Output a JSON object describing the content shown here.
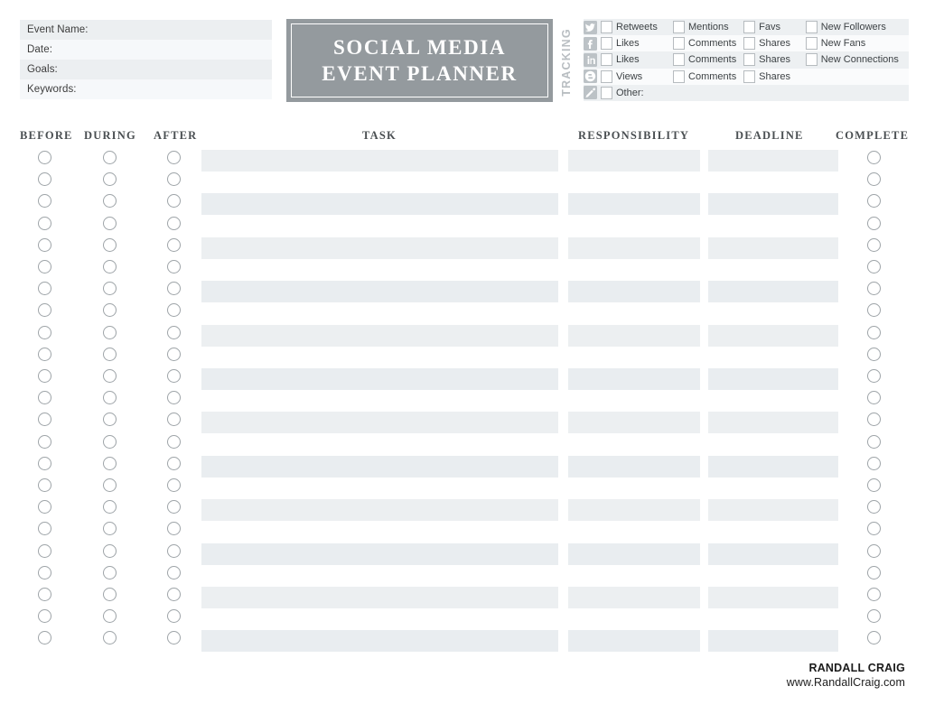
{
  "title": {
    "line1": "SOCIAL MEDIA",
    "line2": "EVENT PLANNER"
  },
  "form": {
    "rows": [
      {
        "label": "Event Name:"
      },
      {
        "label": "Date:"
      },
      {
        "label": "Goals:"
      },
      {
        "label": "Keywords:"
      }
    ]
  },
  "tracking": {
    "label": "TRACKING",
    "rows": [
      {
        "icon": "twitter-icon",
        "cells": [
          "Retweets",
          "Mentions",
          "Favs",
          "New Followers"
        ]
      },
      {
        "icon": "facebook-icon",
        "cells": [
          "Likes",
          "Comments",
          "Shares",
          "New Fans"
        ]
      },
      {
        "icon": "linkedin-icon",
        "cells": [
          "Likes",
          "Comments",
          "Shares",
          "New Connections"
        ]
      },
      {
        "icon": "blogger-icon",
        "cells": [
          "Views",
          "Comments",
          "Shares",
          ""
        ]
      },
      {
        "icon": "pencil-icon",
        "cells": [
          "Other:",
          "",
          "",
          ""
        ]
      }
    ]
  },
  "table": {
    "headers": {
      "before": "BEFORE",
      "during": "DURING",
      "after": "AFTER",
      "task": "TASK",
      "responsibility": "RESPONSIBILITY",
      "deadline": "DEADLINE",
      "complete": "COMPLETE"
    },
    "row_count": 23,
    "rows": [
      {
        "before": "",
        "during": "",
        "after": "",
        "task": "",
        "responsibility": "",
        "deadline": "",
        "complete": ""
      },
      {
        "before": "",
        "during": "",
        "after": "",
        "task": "",
        "responsibility": "",
        "deadline": "",
        "complete": ""
      },
      {
        "before": "",
        "during": "",
        "after": "",
        "task": "",
        "responsibility": "",
        "deadline": "",
        "complete": ""
      },
      {
        "before": "",
        "during": "",
        "after": "",
        "task": "",
        "responsibility": "",
        "deadline": "",
        "complete": ""
      },
      {
        "before": "",
        "during": "",
        "after": "",
        "task": "",
        "responsibility": "",
        "deadline": "",
        "complete": ""
      },
      {
        "before": "",
        "during": "",
        "after": "",
        "task": "",
        "responsibility": "",
        "deadline": "",
        "complete": ""
      },
      {
        "before": "",
        "during": "",
        "after": "",
        "task": "",
        "responsibility": "",
        "deadline": "",
        "complete": ""
      },
      {
        "before": "",
        "during": "",
        "after": "",
        "task": "",
        "responsibility": "",
        "deadline": "",
        "complete": ""
      },
      {
        "before": "",
        "during": "",
        "after": "",
        "task": "",
        "responsibility": "",
        "deadline": "",
        "complete": ""
      },
      {
        "before": "",
        "during": "",
        "after": "",
        "task": "",
        "responsibility": "",
        "deadline": "",
        "complete": ""
      },
      {
        "before": "",
        "during": "",
        "after": "",
        "task": "",
        "responsibility": "",
        "deadline": "",
        "complete": ""
      },
      {
        "before": "",
        "during": "",
        "after": "",
        "task": "",
        "responsibility": "",
        "deadline": "",
        "complete": ""
      },
      {
        "before": "",
        "during": "",
        "after": "",
        "task": "",
        "responsibility": "",
        "deadline": "",
        "complete": ""
      },
      {
        "before": "",
        "during": "",
        "after": "",
        "task": "",
        "responsibility": "",
        "deadline": "",
        "complete": ""
      },
      {
        "before": "",
        "during": "",
        "after": "",
        "task": "",
        "responsibility": "",
        "deadline": "",
        "complete": ""
      },
      {
        "before": "",
        "during": "",
        "after": "",
        "task": "",
        "responsibility": "",
        "deadline": "",
        "complete": ""
      },
      {
        "before": "",
        "during": "",
        "after": "",
        "task": "",
        "responsibility": "",
        "deadline": "",
        "complete": ""
      },
      {
        "before": "",
        "during": "",
        "after": "",
        "task": "",
        "responsibility": "",
        "deadline": "",
        "complete": ""
      },
      {
        "before": "",
        "during": "",
        "after": "",
        "task": "",
        "responsibility": "",
        "deadline": "",
        "complete": ""
      },
      {
        "before": "",
        "during": "",
        "after": "",
        "task": "",
        "responsibility": "",
        "deadline": "",
        "complete": ""
      },
      {
        "before": "",
        "during": "",
        "after": "",
        "task": "",
        "responsibility": "",
        "deadline": "",
        "complete": ""
      },
      {
        "before": "",
        "during": "",
        "after": "",
        "task": "",
        "responsibility": "",
        "deadline": "",
        "complete": ""
      },
      {
        "before": "",
        "during": "",
        "after": "",
        "task": "",
        "responsibility": "",
        "deadline": "",
        "complete": ""
      }
    ]
  },
  "footer": {
    "name": "RANDALL CRAIG",
    "website": "www.RandallCraig.com"
  },
  "colors": {
    "banner": "#949a9e",
    "bar_shade": "#e9edf0",
    "row_shade": "#edf0f2",
    "icon_gray": "#bcc2c6",
    "text": "#3d4245"
  }
}
